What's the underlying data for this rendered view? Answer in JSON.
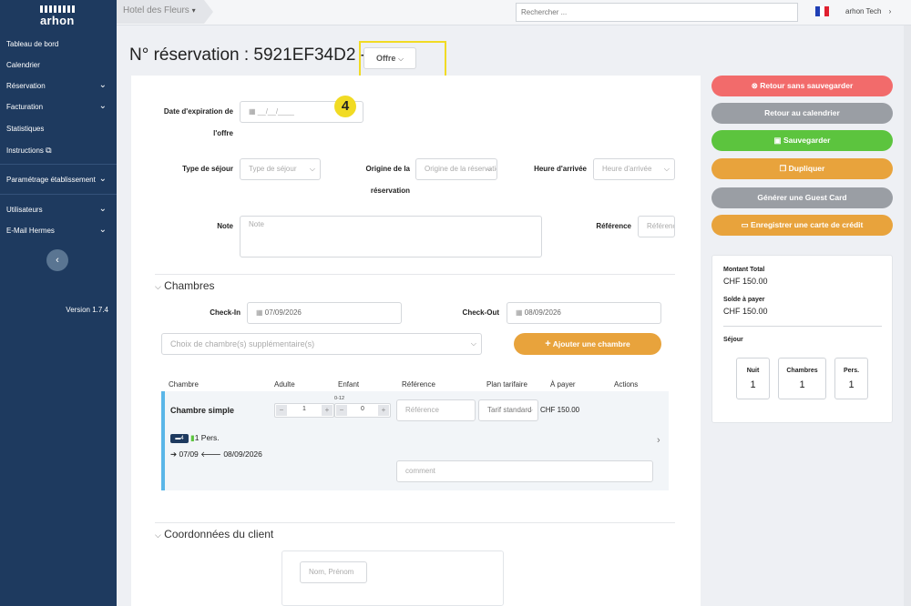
{
  "app": {
    "logo_text": "arhon",
    "version": "Version 1.7.4"
  },
  "sidebar": {
    "items": [
      {
        "label": "Tableau de bord",
        "has_children": false
      },
      {
        "label": "Calendrier",
        "has_children": false
      },
      {
        "label": "Réservation",
        "has_children": true
      },
      {
        "label": "Facturation",
        "has_children": true
      },
      {
        "label": "Statistiques",
        "has_children": false
      },
      {
        "label": "Instructions",
        "has_children": false
      },
      {
        "label": "Paramétrage établissement",
        "has_children": true
      },
      {
        "label": "Utilisateurs",
        "has_children": true
      },
      {
        "label": "E-Mail Hermes",
        "has_children": true
      }
    ]
  },
  "topbar": {
    "hotel": "Hotel des Fleurs",
    "search_placeholder": "Rechercher ...",
    "user": "arhon Tech"
  },
  "page": {
    "title": "N° réservation : 5921EF34D2 -",
    "status_dropdown": "Offre",
    "step_badge": "4"
  },
  "form": {
    "expiration_label_1": "Date d'expiration de",
    "expiration_label_2": "l'offre",
    "expiration_placeholder": "__/__/____",
    "stay_type_label": "Type de séjour",
    "stay_type_placeholder": "Type de séjour",
    "origin_label_1": "Origine de la",
    "origin_label_2": "réservation",
    "origin_placeholder": "Origine de la réservation",
    "arrival_label": "Heure d'arrivée",
    "arrival_placeholder": "Heure d'arrivée",
    "note_label": "Note",
    "note_placeholder": "Note",
    "reference_label": "Référence",
    "reference_placeholder": "Référence"
  },
  "rooms": {
    "section_title": "Chambres",
    "checkin_label": "Check-In",
    "checkin_value": "07/09/2026",
    "checkout_label": "Check-Out",
    "checkout_value": "08/09/2026",
    "room_choice_placeholder": "Choix de chambre(s) supplémentaire(s)",
    "add_room_button": "Ajouter une chambre",
    "columns": [
      "Chambre",
      "Adulte",
      "Enfant",
      "Référence",
      "Plan tarifaire",
      "À payer",
      "Actions"
    ],
    "row": {
      "name": "Chambre simple",
      "adults": "1",
      "children_age": "0-12",
      "children": "0",
      "reference_placeholder": "Référence",
      "rate_plan": "Tarif standard",
      "price": "CHF 150.00",
      "bed_count": "4",
      "persons": "1 Pers.",
      "dates": "07/09 ← 08/09/2026",
      "arrive_date": "07/09",
      "depart_date": "08/09/2026",
      "comment_placeholder": "comment"
    }
  },
  "client": {
    "section_title": "Coordonnées du client",
    "name_placeholder": "Nom, Prénom"
  },
  "actions": {
    "back_no_save": "Retour sans sauvegarder",
    "back_calendar": "Retour au calendrier",
    "save": "Sauvegarder",
    "duplicate": "Dupliquer",
    "guest_card": "Générer une Guest Card",
    "credit_card": "Enregistrer une carte de crédit"
  },
  "summary": {
    "total_label": "Montant Total",
    "total_value": "CHF 150.00",
    "balance_label": "Solde à payer",
    "balance_value": "CHF 150.00",
    "stay_label": "Séjour",
    "nights_label": "Nuit",
    "nights_value": "1",
    "rooms_label": "Chambres",
    "rooms_value": "1",
    "persons_label": "Pers.",
    "persons_value": "1"
  },
  "colors": {
    "sidebar": "#1e3a5f",
    "danger": "#f26b6b",
    "secondary": "#9a9ea4",
    "success": "#5cc43e",
    "warning": "#e8a33c",
    "highlight": "#f1db24",
    "accent_bar": "#5ab6e8"
  }
}
